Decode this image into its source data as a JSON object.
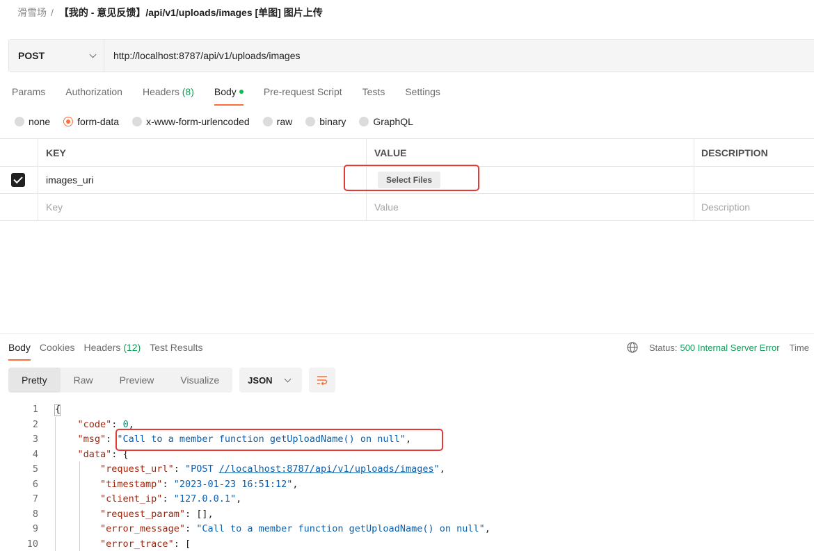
{
  "breadcrumb": {
    "parent": "滑雪场",
    "separator": "/",
    "current": "【我的 - 意见反馈】/api/v1/uploads/images [单图] 图片上传"
  },
  "request": {
    "method": "POST",
    "url": "http://localhost:8787/api/v1/uploads/images"
  },
  "request_tabs": [
    {
      "label": "Params"
    },
    {
      "label": "Authorization"
    },
    {
      "label": "Headers",
      "count": "(8)"
    },
    {
      "label": "Body",
      "active": true,
      "has_dot": true
    },
    {
      "label": "Pre-request Script"
    },
    {
      "label": "Tests"
    },
    {
      "label": "Settings"
    }
  ],
  "body_types": [
    {
      "label": "none",
      "checked": false
    },
    {
      "label": "form-data",
      "checked": true
    },
    {
      "label": "x-www-form-urlencoded",
      "checked": false
    },
    {
      "label": "raw",
      "checked": false
    },
    {
      "label": "binary",
      "checked": false
    },
    {
      "label": "GraphQL",
      "checked": false
    }
  ],
  "form_table": {
    "headers": {
      "key": "KEY",
      "value": "VALUE",
      "description": "DESCRIPTION"
    },
    "row": {
      "key": "images_uri",
      "value_button": "Select Files",
      "checked": true
    },
    "placeholders": {
      "key": "Key",
      "value": "Value",
      "description": "Description"
    }
  },
  "response_tabs": [
    {
      "label": "Body",
      "active": true
    },
    {
      "label": "Cookies"
    },
    {
      "label": "Headers",
      "count": "(12)"
    },
    {
      "label": "Test Results"
    }
  ],
  "status": {
    "label": "Status:",
    "value": "500 Internal Server Error",
    "time_label": "Time"
  },
  "view_modes": [
    "Pretty",
    "Raw",
    "Preview",
    "Visualize"
  ],
  "active_view": "Pretty",
  "format": "JSON",
  "code_lines": [
    {
      "n": "1",
      "t": "{"
    },
    {
      "n": "2",
      "t": "    \"code\": 0,"
    },
    {
      "n": "3",
      "t": "    \"msg\": \"Call to a member function getUploadName() on null\","
    },
    {
      "n": "4",
      "t": "    \"data\": {"
    },
    {
      "n": "5",
      "t": "        \"request_url\": \"POST //localhost:8787/api/v1/uploads/images\","
    },
    {
      "n": "6",
      "t": "        \"timestamp\": \"2023-01-23 16:51:12\","
    },
    {
      "n": "7",
      "t": "        \"client_ip\": \"127.0.0.1\","
    },
    {
      "n": "8",
      "t": "        \"request_param\": [],"
    },
    {
      "n": "9",
      "t": "        \"error_message\": \"Call to a member function getUploadName() on null\","
    },
    {
      "n": "10",
      "t": "        \"error_trace\": ["
    }
  ],
  "colors": {
    "accent": "#ff6c37",
    "status_ok": "#0f9d58",
    "highlight": "#e53935",
    "json_key": "#a1260d",
    "json_string": "#0b5fac",
    "json_number": "#0b8a79"
  }
}
